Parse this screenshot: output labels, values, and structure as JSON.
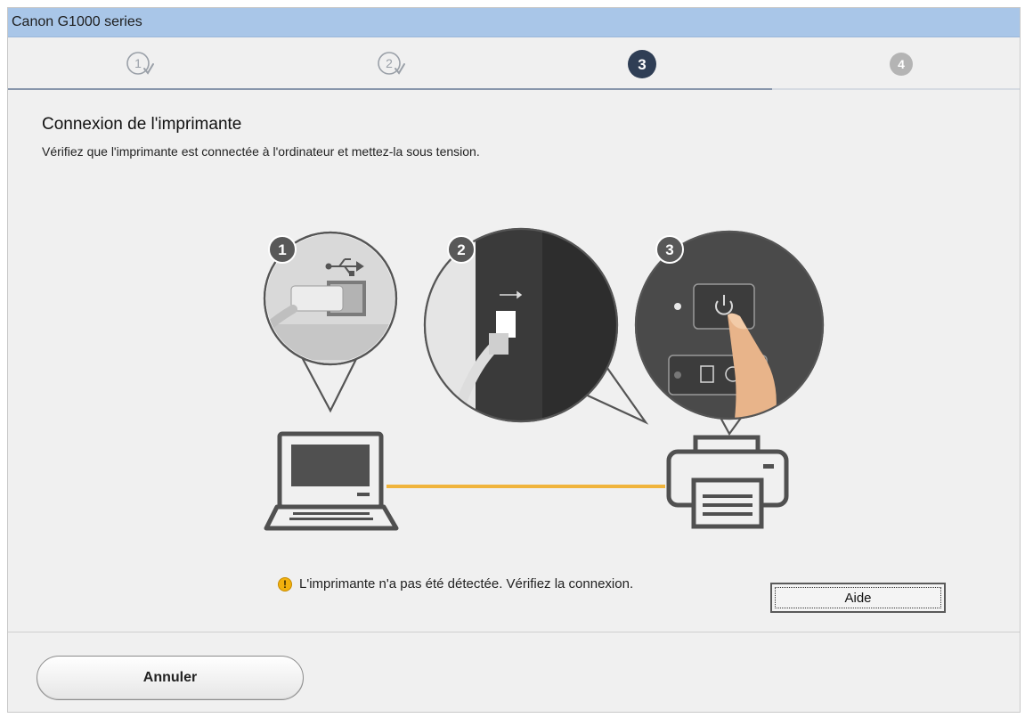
{
  "window": {
    "title": "Canon G1000 series"
  },
  "steps": [
    {
      "label": "1",
      "state": "done"
    },
    {
      "label": "2",
      "state": "done"
    },
    {
      "label": "3",
      "state": "current"
    },
    {
      "label": "4",
      "state": "pending"
    }
  ],
  "main": {
    "heading": "Connexion de l'imprimante",
    "instruction": "Vérifiez que l'imprimante est connectée à l'ordinateur et mettez-la sous tension.",
    "callouts": [
      {
        "number": "1"
      },
      {
        "number": "2"
      },
      {
        "number": "3"
      }
    ],
    "status_message": "L'imprimante n'a pas été détectée. Vérifiez la connexion.",
    "status_icon": "warning-icon",
    "help_label": "Aide"
  },
  "footer": {
    "cancel_label": "Annuler"
  },
  "colors": {
    "titlebar": "#a9c6e8",
    "cable": "#f0b43c",
    "step_current": "#2f3e55",
    "step_pending": "#b4b4b4",
    "step_done": "#9aa0a8",
    "warning": "#f2b10d"
  }
}
